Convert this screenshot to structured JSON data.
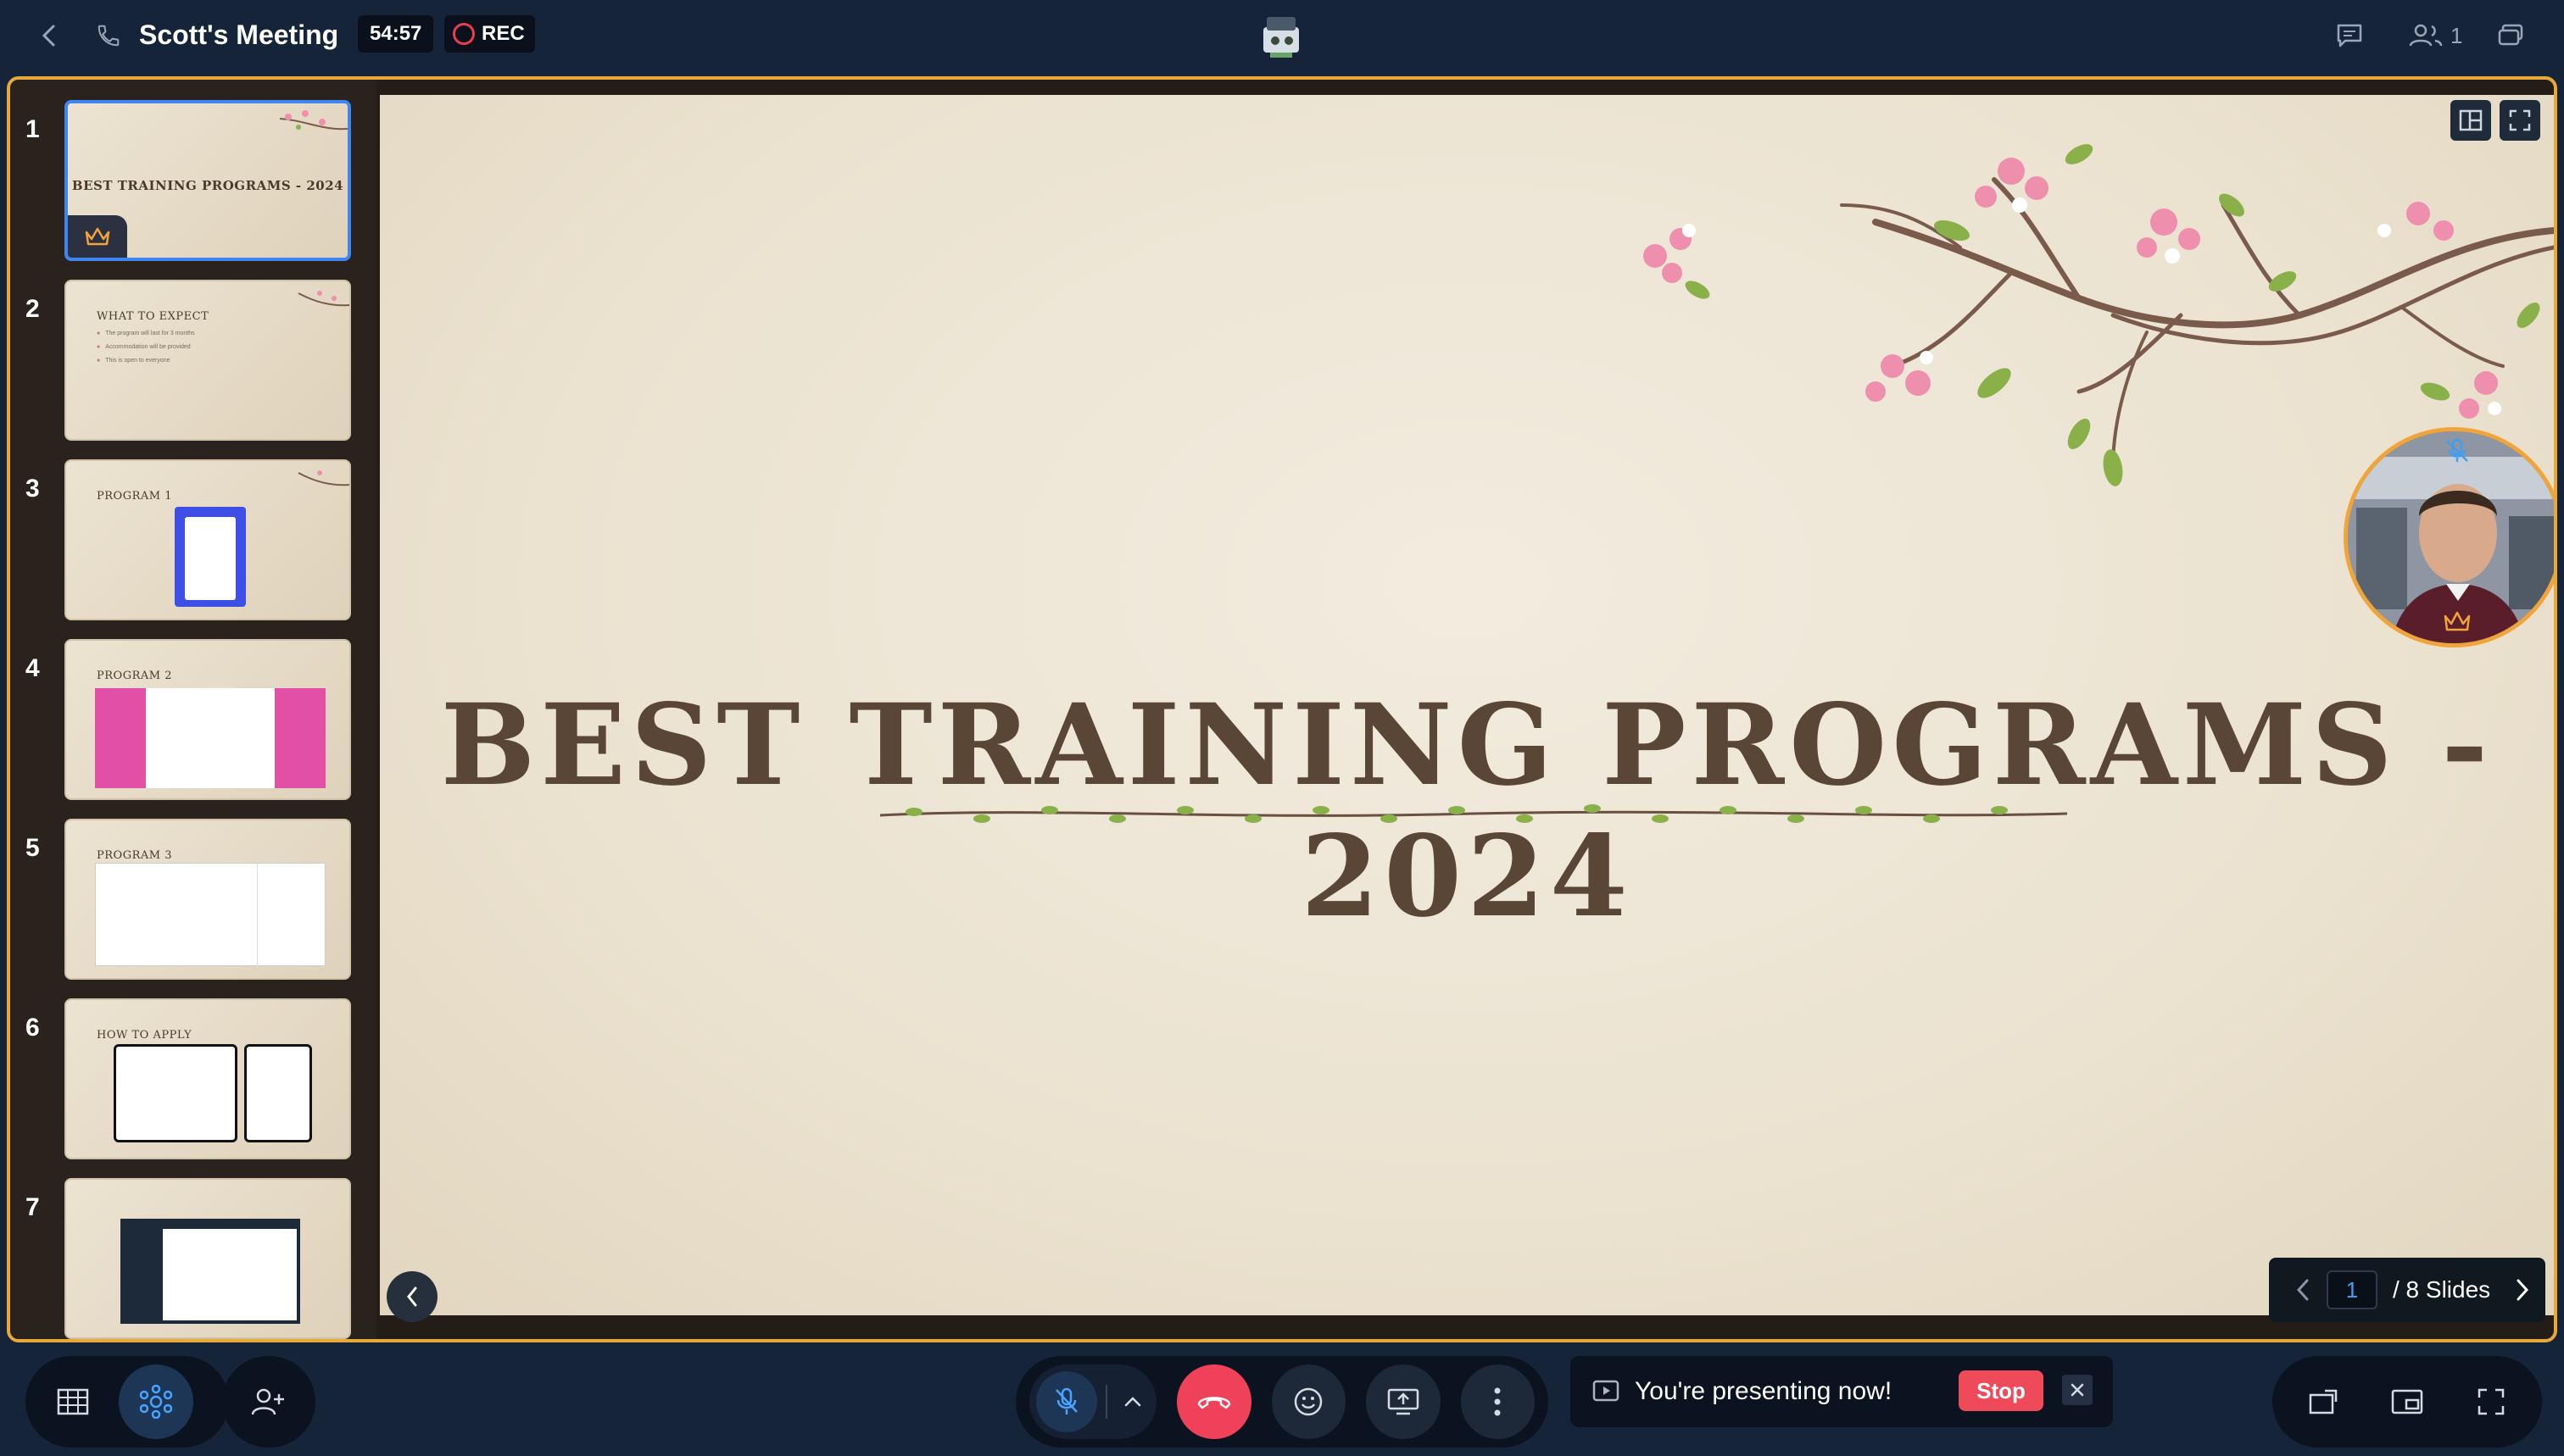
{
  "topbar": {
    "title": "Scott's Meeting",
    "timer": "54:57",
    "rec_label": "REC",
    "participants_count": "1"
  },
  "thumbnails": [
    {
      "num": "1",
      "title": "BEST TRAINING PROGRAMS - 2024",
      "active": true
    },
    {
      "num": "2",
      "title": "WHAT TO EXPECT",
      "bullets": [
        "The program will last for 3 months",
        "Accommodation will be provided",
        "This is open to everyone"
      ]
    },
    {
      "num": "3",
      "title": "PROGRAM 1"
    },
    {
      "num": "4",
      "title": "PROGRAM 2"
    },
    {
      "num": "5",
      "title": "PROGRAM 3"
    },
    {
      "num": "6",
      "title": "HOW TO APPLY"
    },
    {
      "num": "7",
      "title": ""
    }
  ],
  "slide": {
    "title": "BEST TRAINING PROGRAMS - 2024"
  },
  "pager": {
    "current": "1",
    "total_label": "/ 8 Slides"
  },
  "presenting": {
    "text": "You're presenting now!",
    "stop_label": "Stop"
  },
  "colors": {
    "accent_border": "#e8a93a",
    "end_call": "#f0415a",
    "active_thumb": "#3f86f0"
  }
}
